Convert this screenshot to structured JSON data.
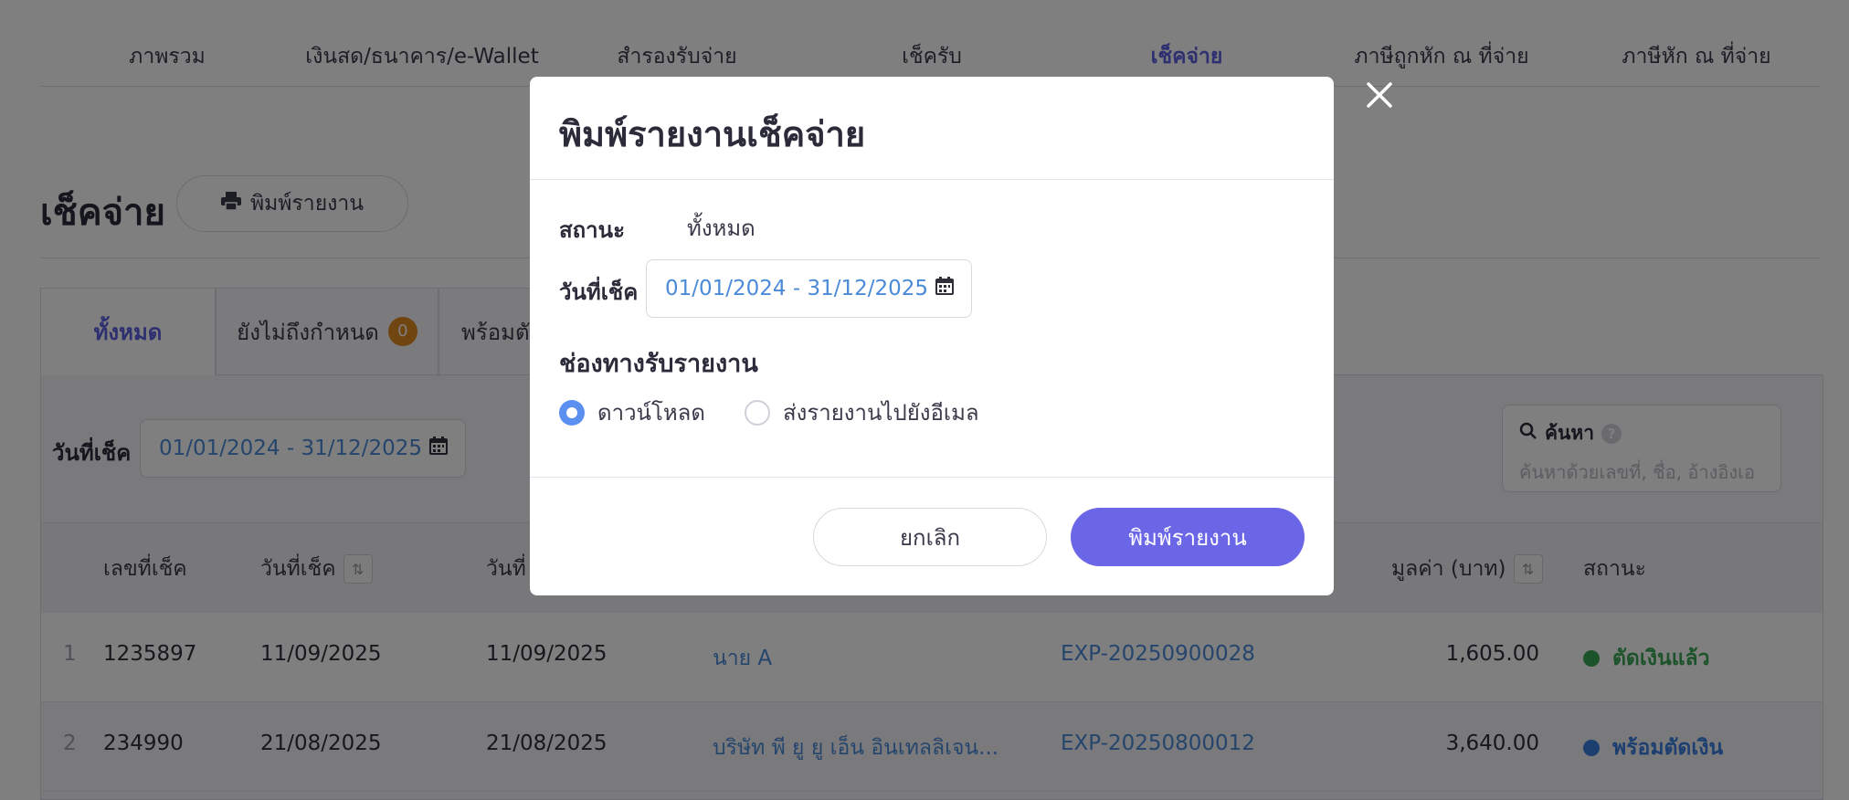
{
  "topnav": {
    "tabs": [
      {
        "label": "ภาพรวม"
      },
      {
        "label": "เงินสด/ธนาคาร/e-Wallet"
      },
      {
        "label": "สำรองรับจ่าย"
      },
      {
        "label": "เช็ครับ"
      },
      {
        "label": "เช็คจ่าย"
      },
      {
        "label": "ภาษีถูกหัก ณ ที่จ่าย"
      },
      {
        "label": "ภาษีหัก ณ ที่จ่าย"
      }
    ],
    "active_index": 4
  },
  "header": {
    "title": "เช็คจ่าย",
    "print_button_label": "พิมพ์รายงาน"
  },
  "status_tabs": [
    {
      "label": "ทั้งหมด"
    },
    {
      "label": "ยังไม่ถึงกำหนด",
      "badge": "0"
    },
    {
      "label": "พร้อมตั"
    }
  ],
  "filter": {
    "date_label": "วันที่เช็ค",
    "date_range": "01/01/2024 - 31/12/2025",
    "search_label": "ค้นหา",
    "search_help": "?",
    "search_placeholder": "ค้นหาด้วยเลขที่, ชื่อ, อ้างอิงเอ"
  },
  "table": {
    "columns": {
      "cheque_no": "เลขที่เช็ค",
      "cheque_date": "วันที่เช็ค",
      "col3": "วันที่",
      "amount": "มูลค่า (บาท)",
      "status": "สถานะ"
    },
    "rows": [
      {
        "index": "1",
        "cheque_no": "1235897",
        "cheque_date": "11/09/2025",
        "date2": "11/09/2025",
        "payee": "นาย A",
        "ref": "EXP-20250900028",
        "amount": "1,605.00",
        "status": "ตัดเงินแล้ว",
        "status_color": "#3aa655"
      },
      {
        "index": "2",
        "cheque_no": "234990",
        "cheque_date": "21/08/2025",
        "date2": "21/08/2025",
        "payee": "บริษัท พี ยู ยู เอ็น อินเทลลิเจน...",
        "ref": "EXP-20250800012",
        "amount": "3,640.00",
        "status": "พร้อมตัดเงิน",
        "status_color": "#3b7fe0"
      }
    ]
  },
  "modal": {
    "title": "พิมพ์รายงานเช็คจ่าย",
    "status_label": "สถานะ",
    "status_value": "ทั้งหมด",
    "date_label": "วันที่เช็ค",
    "date_range": "01/01/2024 - 31/12/2025",
    "channel_title": "ช่องทางรับรายงาน",
    "option_download": "ดาวน์โหลด",
    "option_email": "ส่งรายงานไปยังอีเมล",
    "selected_option": "download",
    "cancel_label": "ยกเลิก",
    "submit_label": "พิมพ์รายงาน"
  },
  "colors": {
    "accent": "#5b5ee0",
    "primary_button": "#6b66e6",
    "link": "#4a8ad8",
    "badge": "#e08a1e"
  }
}
